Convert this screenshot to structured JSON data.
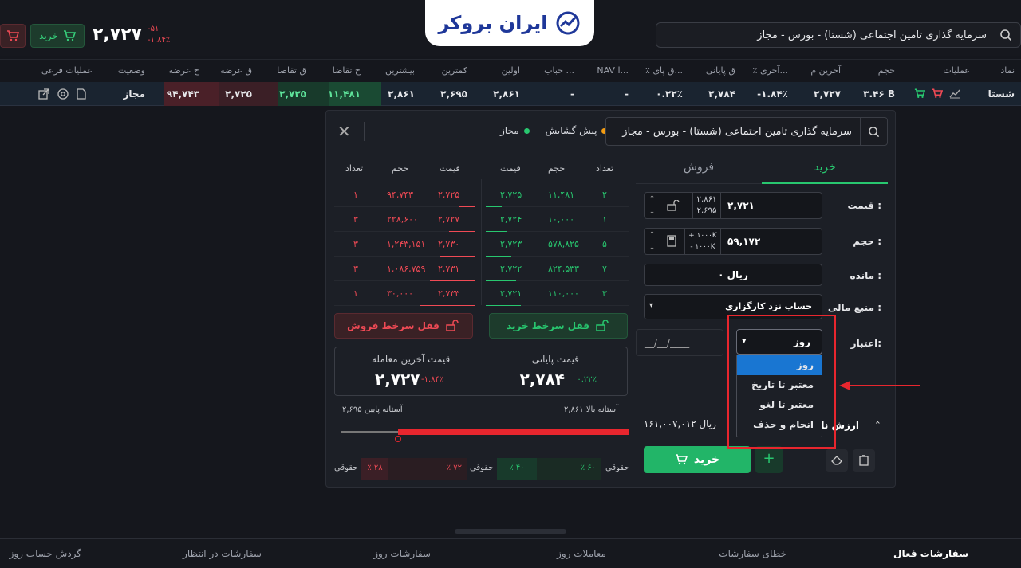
{
  "brand": {
    "logo_text": "ایران بروکر"
  },
  "top": {
    "search_text": "سرمایه گذاری تامین اجتماعی (شستا) - بورس - مجاز",
    "buy_label": "خرید",
    "price": "۲,۷۲۷",
    "change_abs": "-۵۱",
    "change_pct": "-۱.۸۴٪"
  },
  "columns": [
    "نماد",
    "عملیات",
    "حجم",
    "آخرین م",
    "٪ آخری...",
    "ق پایانی",
    "٪ ق پای...",
    "NAV ا...",
    "حباب ...",
    "اولین",
    "کمترین",
    "بیشترین",
    "ح تقاضا",
    "ق تقاضا",
    "ق عرضه",
    "ح عرضه",
    "وضعیت",
    "عملیات فرعی"
  ],
  "row": {
    "symbol": "شستا",
    "volume": "۳.۴۶ B",
    "last": "۲,۷۲۷",
    "last_pct": "-۱.۸۴٪",
    "close": "۲,۷۸۴",
    "close_pct": "۰.۲۲٪",
    "nav": "-",
    "bubble": "-",
    "first": "۲,۸۶۱",
    "low": "۲,۶۹۵",
    "high": "۲,۸۶۱",
    "bid_vol": "۱۱,۴۸۱",
    "bid_price": "۲,۷۲۵",
    "ask_price": "۲,۷۲۵",
    "ask_vol": "۹۴,۷۴۳",
    "status": "مجاز"
  },
  "panel": {
    "search_text": "سرمایه گذاری تامین اجتماعی (شستا) - بورس - مجاز",
    "status_preopen": "پیش گشایش",
    "status_allowed": "مجاز",
    "tab_buy": "خرید",
    "tab_sell": "فروش",
    "price_label": "قیمت :",
    "price_value": "۲,۷۲۱",
    "price_upper": "۲,۸۶۱",
    "price_lower": "۲,۶۹۵",
    "volume_label": "حجم :",
    "volume_value": "۵۹,۱۷۲",
    "vol_plus": "+ ۱۰۰۰K",
    "vol_minus": "- ۱۰۰۰K",
    "remain_label": "مانده :",
    "remain_value": "۰ ریال",
    "fund_label": "منبع مالی :",
    "fund_value": "حساب نزد کارگزاری",
    "validity_label": "اعتبار:",
    "validity_value": "روز",
    "date_placeholder": "__/__/____",
    "net_label": "ارزش ناخالص",
    "net_value": "۱۶۱,۰۰۷,۰۱۲ ریال",
    "submit_label": "خرید",
    "dropdown": [
      "روز",
      "معتبر تا تاریخ",
      "معتبر تا لغو",
      "انجام و حذف"
    ]
  },
  "orderbook": {
    "headers_buy": [
      "تعداد",
      "حجم",
      "قیمت"
    ],
    "headers_sell": [
      "قیمت",
      "حجم",
      "تعداد"
    ],
    "buy": [
      {
        "count": "۲",
        "vol": "۱۱,۴۸۱",
        "price": "۲,۷۲۵"
      },
      {
        "count": "۱",
        "vol": "۱۰,۰۰۰",
        "price": "۲,۷۲۴"
      },
      {
        "count": "۵",
        "vol": "۵۷۸,۸۲۵",
        "price": "۲,۷۲۳"
      },
      {
        "count": "۷",
        "vol": "۸۲۴,۵۳۳",
        "price": "۲,۷۲۲"
      },
      {
        "count": "۳",
        "vol": "۱۱۰,۰۰۰",
        "price": "۲,۷۲۱"
      }
    ],
    "sell": [
      {
        "price": "۲,۷۲۵",
        "vol": "۹۴,۷۴۳",
        "count": "۱"
      },
      {
        "price": "۲,۷۲۷",
        "vol": "۲۲۸,۶۰۰",
        "count": "۳"
      },
      {
        "price": "۲,۷۳۰",
        "vol": "۱,۲۴۳,۱۵۱",
        "count": "۳"
      },
      {
        "price": "۲,۷۳۱",
        "vol": "۱,۰۸۶,۷۵۹",
        "count": "۳"
      },
      {
        "price": "۲,۷۳۳",
        "vol": "۳۰,۰۰۰",
        "count": "۱"
      }
    ],
    "lock_buy": "قفل سرخط خرید",
    "lock_sell": "قفل سرخط فروش"
  },
  "stats": {
    "close_label": "قیمت پایانی",
    "close_value": "۲,۷۸۴",
    "close_pct": "۰.۲۲٪",
    "last_label": "قیمت آخرین معامله",
    "last_value": "۲,۷۲۷",
    "last_pct": "-۱.۸۴٪",
    "upper_label": "آستانه بالا ۲,۸۶۱",
    "lower_label": "۲,۶۹۵ آستانه پایین",
    "legal_label": "حقوقی",
    "pct60": "٪ ۶۰",
    "pct40": "٪ ۴۰",
    "pct72": "٪ ۷۲",
    "pct28": "٪ ۲۸"
  },
  "bottom_tabs": [
    "سفارشات فعال",
    "خطای سفارشات",
    "معاملات روز",
    "سفارشات روز",
    "سفارشات در انتظار",
    "گردش حساب روز"
  ],
  "colors": {
    "buy": "#28c76f",
    "sell": "#f04a55",
    "annotation": "#e8262e"
  }
}
